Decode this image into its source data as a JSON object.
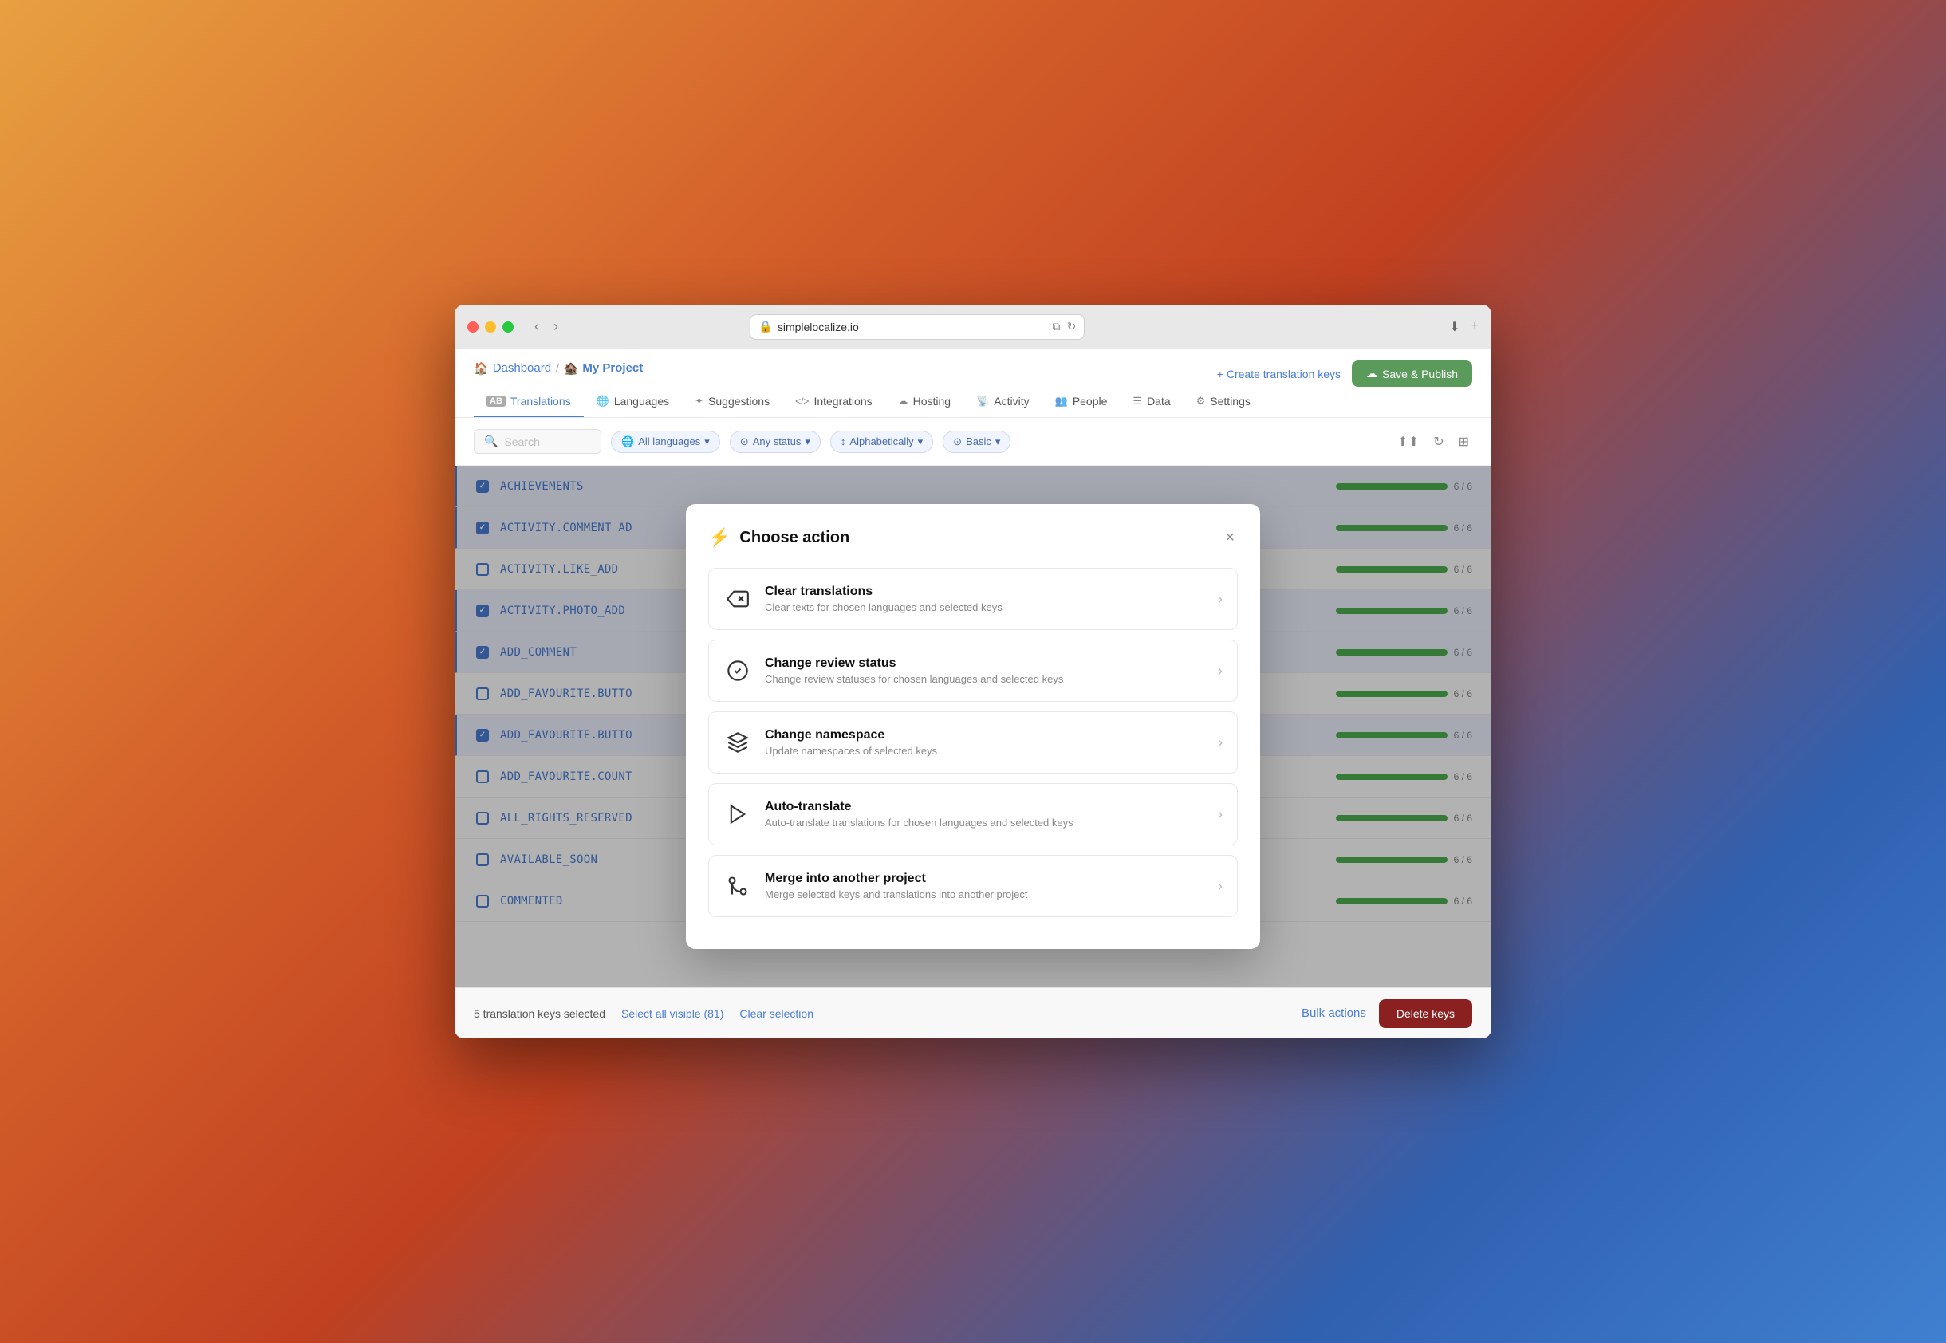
{
  "browser": {
    "url": "simplelocalize.io",
    "lock_icon": "🔒"
  },
  "header": {
    "breadcrumb": {
      "dashboard_label": "Dashboard",
      "separator": "/",
      "project_emoji": "🏚️",
      "project_name": "My Project"
    },
    "create_translation_keys_label": "+ Create translation keys",
    "save_publish_label": "Save & Publish"
  },
  "nav_tabs": [
    {
      "id": "translations",
      "label": "Translations",
      "icon": "AB",
      "active": true
    },
    {
      "id": "languages",
      "label": "Languages",
      "icon": "🌐",
      "active": false
    },
    {
      "id": "suggestions",
      "label": "Suggestions",
      "icon": "✦",
      "active": false
    },
    {
      "id": "integrations",
      "label": "Integrations",
      "icon": "</>",
      "active": false
    },
    {
      "id": "hosting",
      "label": "Hosting",
      "icon": "☁",
      "active": false
    },
    {
      "id": "activity",
      "label": "Activity",
      "icon": "((·))",
      "active": false
    },
    {
      "id": "people",
      "label": "People",
      "icon": "👥",
      "active": false
    },
    {
      "id": "data",
      "label": "Data",
      "icon": "☰",
      "active": false
    },
    {
      "id": "settings",
      "label": "Settings",
      "icon": "⚙",
      "active": false
    }
  ],
  "filter_bar": {
    "search_placeholder": "Search",
    "filters": [
      {
        "label": "All languages",
        "icon": "🌐"
      },
      {
        "label": "Any status",
        "icon": "⊙"
      },
      {
        "label": "Alphabetically",
        "icon": "↑↓"
      },
      {
        "label": "Basic",
        "icon": "⊙"
      }
    ]
  },
  "table_rows": [
    {
      "key": "ACHIEVEMENTS",
      "checked": true,
      "progress": 100,
      "label": "6 / 6"
    },
    {
      "key": "ACTIVITY.COMMENT_AD",
      "checked": true,
      "progress": 100,
      "label": "6 / 6"
    },
    {
      "key": "ACTIVITY.LIKE_ADD",
      "checked": false,
      "progress": 100,
      "label": "6 / 6"
    },
    {
      "key": "ACTIVITY.PHOTO_ADD",
      "checked": true,
      "progress": 100,
      "label": "6 / 6"
    },
    {
      "key": "ADD_COMMENT",
      "checked": true,
      "progress": 100,
      "label": "6 / 6"
    },
    {
      "key": "ADD_FAVOURITE.BUTTO",
      "checked": false,
      "progress": 100,
      "label": "6 / 6"
    },
    {
      "key": "ADD_FAVOURITE.BUTTO",
      "checked": true,
      "progress": 100,
      "label": "6 / 6"
    },
    {
      "key": "ADD_FAVOURITE.COUNT",
      "checked": false,
      "progress": 100,
      "label": "6 / 6"
    },
    {
      "key": "ALL_RIGHTS_RESERVED",
      "checked": false,
      "progress": 100,
      "label": "6 / 6"
    },
    {
      "key": "AVAILABLE_SOON",
      "checked": false,
      "progress": 100,
      "label": "6 / 6"
    },
    {
      "key": "COMMENTED",
      "checked": false,
      "progress": 100,
      "label": "6 / 6"
    }
  ],
  "bottom_bar": {
    "status_text": "5 translation keys selected",
    "select_all_label": "Select all visible (81)",
    "clear_selection_label": "Clear selection",
    "bulk_actions_label": "Bulk actions",
    "delete_keys_label": "Delete keys"
  },
  "modal": {
    "title": "Choose action",
    "title_icon": "⚡",
    "close_icon": "×",
    "actions": [
      {
        "id": "clear-translations",
        "title": "Clear translations",
        "description": "Clear texts for chosen languages and selected keys",
        "icon_type": "backspace"
      },
      {
        "id": "change-review-status",
        "title": "Change review status",
        "description": "Change review statuses for chosen languages and selected keys",
        "icon_type": "check-circle"
      },
      {
        "id": "change-namespace",
        "title": "Change namespace",
        "description": "Update namespaces of selected keys",
        "icon_type": "layers"
      },
      {
        "id": "auto-translate",
        "title": "Auto-translate",
        "description": "Auto-translate translations for chosen languages and selected keys",
        "icon_type": "play"
      },
      {
        "id": "merge-project",
        "title": "Merge into another project",
        "description": "Merge selected keys and translations into another project",
        "icon_type": "merge"
      }
    ]
  }
}
